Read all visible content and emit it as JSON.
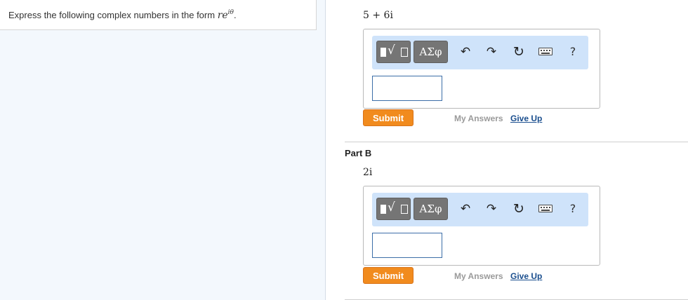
{
  "instruction": {
    "text": "Express the following complex numbers in the form ",
    "form_base": "re",
    "form_exponent": "iθ",
    "form_end": "."
  },
  "parts": [
    {
      "title": "",
      "expression": "5 + 6i",
      "toolbar": {
        "symbols_label": "ΑΣφ",
        "help_label": "?"
      },
      "answer_value": "",
      "submit_label": "Submit",
      "my_answers_label": "My Answers",
      "give_up_label": "Give Up"
    },
    {
      "title": "Part B",
      "expression": "2i",
      "toolbar": {
        "symbols_label": "ΑΣφ",
        "help_label": "?"
      },
      "answer_value": "",
      "submit_label": "Submit",
      "my_answers_label": "My Answers",
      "give_up_label": "Give Up"
    }
  ],
  "colors": {
    "submit": "#f18b1e",
    "toolbar_bg": "#cfe3fa",
    "link": "#1a4e8e",
    "left_pane_bg": "#f3f8fd"
  }
}
